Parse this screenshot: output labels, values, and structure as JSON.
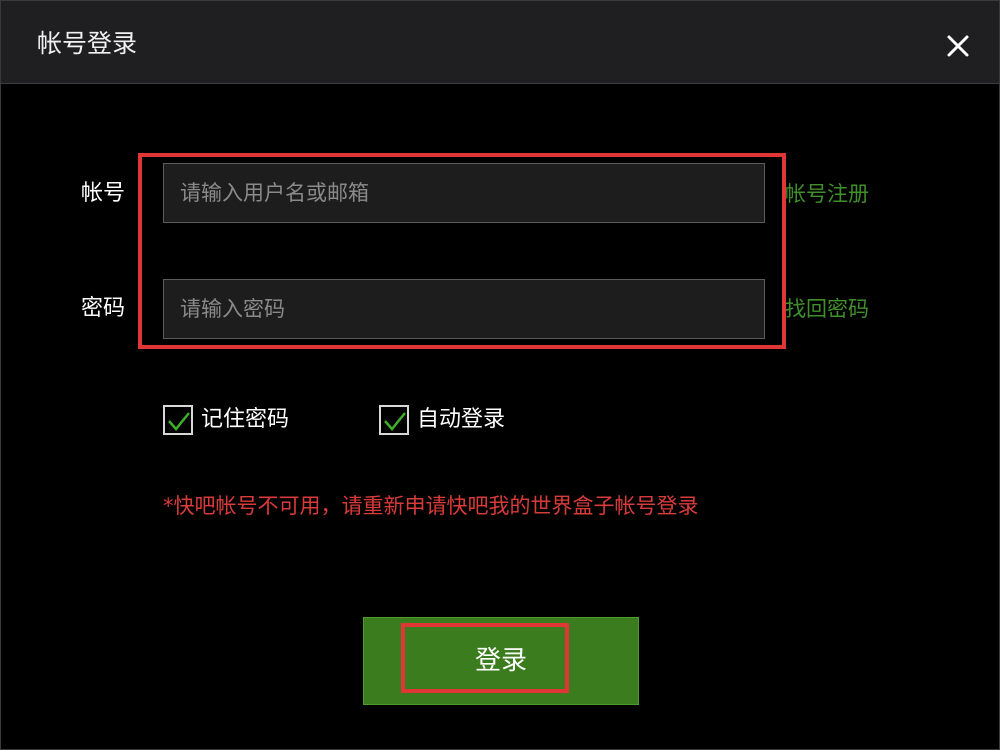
{
  "window": {
    "title": "帐号登录",
    "close_icon": "close-icon"
  },
  "form": {
    "account": {
      "label": "帐号",
      "placeholder": "请输入用户名或邮箱",
      "value": "",
      "link": "帐号注册"
    },
    "password": {
      "label": "密码",
      "placeholder": "请输入密码",
      "value": "",
      "link": "找回密码"
    }
  },
  "options": {
    "remember": {
      "label": "记住密码",
      "checked": true
    },
    "auto_login": {
      "label": "自动登录",
      "checked": true
    }
  },
  "notice": "*快吧帐号不可用，请重新申请快吧我的世界盒子帐号登录",
  "login_button": {
    "label": "登录"
  },
  "colors": {
    "accent_green": "#3b7d1e",
    "link_green": "#3f8f2a",
    "check_green": "#3fae2a",
    "notice_red": "#d93a3a",
    "highlight_red": "#e03636",
    "background": "#000000",
    "titlebar": "#1f1f22"
  }
}
